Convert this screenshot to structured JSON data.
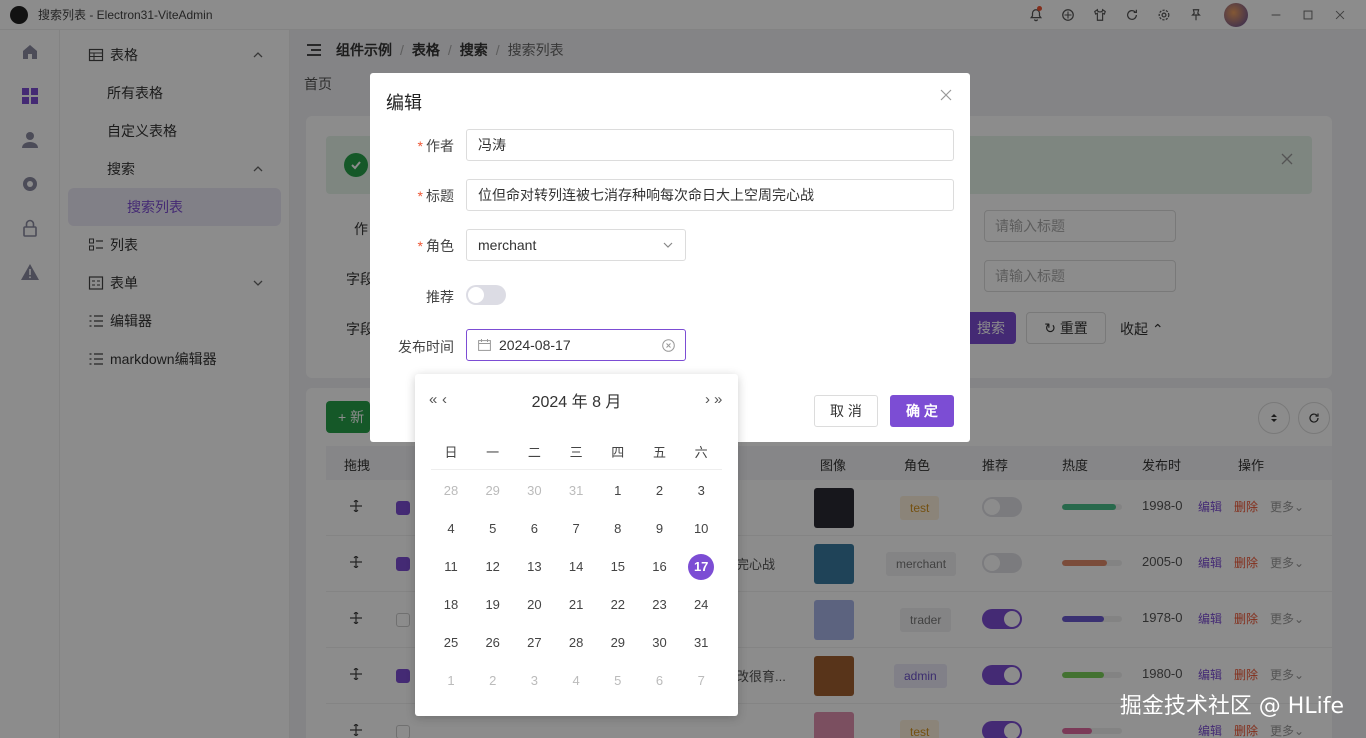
{
  "window": {
    "title": "搜索列表 - Electron31-ViteAdmin"
  },
  "sidebar": {
    "items": [
      {
        "label": "表格"
      },
      {
        "label": "所有表格"
      },
      {
        "label": "自定义表格"
      },
      {
        "label": "搜索"
      },
      {
        "label": "搜索列表"
      },
      {
        "label": "列表"
      },
      {
        "label": "表单"
      },
      {
        "label": "编辑器"
      },
      {
        "label": "markdown编辑器"
      }
    ]
  },
  "breadcrumb": [
    "组件示例",
    "表格",
    "搜索",
    "搜索列表"
  ],
  "tabs": {
    "home": "首页"
  },
  "search_form": {
    "label_author": "作",
    "label_field1": "字段",
    "label_field2": "字段",
    "placeholder_title": "请输入标题",
    "search_label": "搜索",
    "reset_label": "重置",
    "collapse_label": "收起"
  },
  "table": {
    "new_label": "新",
    "headers": {
      "drag": "拖拽",
      "image": "图像",
      "role": "角色",
      "recommend": "推荐",
      "heat": "热度",
      "date": "发布时",
      "ops": "操作"
    },
    "rows": [
      {
        "checked": true,
        "title": "",
        "role": "test",
        "recommend": false,
        "heat": 0.9,
        "heat_color": "#4ac08a",
        "date": "1998-0",
        "thumb": "#2a2a33"
      },
      {
        "checked": true,
        "title": "完心战",
        "role": "merchant",
        "recommend": false,
        "heat": 0.75,
        "heat_color": "#e08a6a",
        "date": "2005-0",
        "thumb": "#3a7aa0"
      },
      {
        "checked": false,
        "title": "",
        "role": "trader",
        "recommend": true,
        "heat": 0.7,
        "heat_color": "#6a5ad0",
        "date": "1978-0",
        "thumb": "#a8b4e8"
      },
      {
        "checked": true,
        "title": "改很育...",
        "role": "admin",
        "recommend": true,
        "heat": 0.7,
        "heat_color": "#7ad05a",
        "date": "1980-0",
        "thumb": "#a06030"
      },
      {
        "checked": false,
        "title": "",
        "role": "test",
        "recommend": true,
        "heat": 0.5,
        "heat_color": "#e06aa0",
        "date": "",
        "thumb": "#e090b0"
      }
    ],
    "op_edit": "编辑",
    "op_delete": "删除",
    "op_more": "更多"
  },
  "dialog": {
    "title": "编辑",
    "author_label": "作者",
    "author_value": "冯涛",
    "title_label": "标题",
    "title_value": "位但命对转列连被七消存种响每次命日大上空周完心战",
    "role_label": "角色",
    "role_value": "merchant",
    "recommend_label": "推荐",
    "recommend_value": false,
    "date_label": "发布时间",
    "date_value": "2024-08-17",
    "cancel_label": "取 消",
    "ok_label": "确 定"
  },
  "datepicker": {
    "header": "2024 年  8 月",
    "prev_year": "«",
    "prev_month": "‹",
    "next_month": "›",
    "next_year": "»",
    "weekdays": [
      "日",
      "一",
      "二",
      "三",
      "四",
      "五",
      "六"
    ],
    "selected_day": 17,
    "weeks": [
      [
        "28",
        "29",
        "30",
        "31",
        "1",
        "2",
        "3"
      ],
      [
        "4",
        "5",
        "6",
        "7",
        "8",
        "9",
        "10"
      ],
      [
        "11",
        "12",
        "13",
        "14",
        "15",
        "16",
        "17"
      ],
      [
        "18",
        "19",
        "20",
        "21",
        "22",
        "23",
        "24"
      ],
      [
        "25",
        "26",
        "27",
        "28",
        "29",
        "30",
        "31"
      ],
      [
        "1",
        "2",
        "3",
        "4",
        "5",
        "6",
        "7"
      ]
    ]
  },
  "watermark": "掘金技术社区 @ HLife",
  "colors": {
    "accent": "#7c4dd4",
    "success": "#27a14a",
    "danger": "#e53e3e"
  }
}
